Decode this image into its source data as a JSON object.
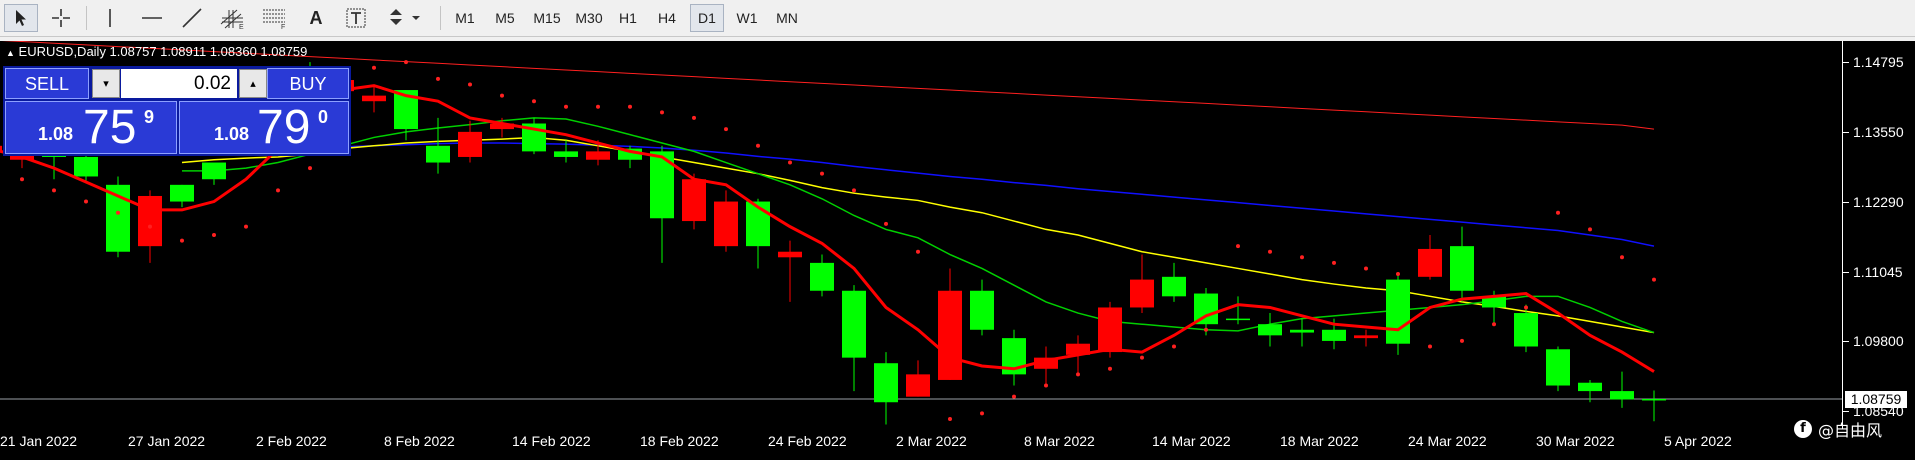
{
  "toolbar": {
    "timeframes": [
      {
        "label": "M1",
        "active": false
      },
      {
        "label": "M5",
        "active": false
      },
      {
        "label": "M15",
        "active": false
      },
      {
        "label": "M30",
        "active": false
      },
      {
        "label": "H1",
        "active": false
      },
      {
        "label": "H4",
        "active": false
      },
      {
        "label": "D1",
        "active": true
      },
      {
        "label": "W1",
        "active": false
      },
      {
        "label": "MN",
        "active": false
      }
    ],
    "tools": [
      "cursor-icon",
      "crosshair-icon",
      "vertical-line-icon",
      "horizontal-line-icon",
      "trendline-icon",
      "equidistant-channel-icon",
      "fibonacci-icon",
      "text-icon",
      "text-label-icon",
      "arrows-icon"
    ],
    "text_tool_label": "A"
  },
  "chart": {
    "symbol_line": "EURUSD,Daily  1.08757 1.08911 1.08360 1.08759",
    "current_price": "1.08759",
    "price_ticks": [
      "1.14795",
      "1.13550",
      "1.12290",
      "1.11045",
      "1.09800",
      "1.08540"
    ],
    "date_ticks": [
      "21 Jan 2022",
      "27 Jan 2022",
      "2 Feb 2022",
      "8 Feb 2022",
      "14 Feb 2022",
      "18 Feb 2022",
      "24 Feb 2022",
      "2 Mar 2022",
      "8 Mar 2022",
      "14 Mar 2022",
      "18 Mar 2022",
      "24 Mar 2022",
      "30 Mar 2022",
      "5 Apr 2022"
    ],
    "colors": {
      "bull": "#00ff00",
      "bear": "#ff0000",
      "ma_fast": "#ff0000",
      "ma_green": "#00d000",
      "ma_yellow": "#ffff00",
      "ma_blue": "#1010ff",
      "ma_slow": "#ff2020",
      "background": "#000000"
    }
  },
  "chart_data": {
    "type": "candlestick",
    "ylim": [
      1.0822,
      1.1518
    ],
    "candles": [
      {
        "o": 1.133,
        "h": 1.136,
        "l": 1.13,
        "c": 1.132
      },
      {
        "o": 1.133,
        "h": 1.134,
        "l": 1.129,
        "c": 1.1305
      },
      {
        "o": 1.131,
        "h": 1.1345,
        "l": 1.127,
        "c": 1.133
      },
      {
        "o": 1.1275,
        "h": 1.132,
        "l": 1.1265,
        "c": 1.131
      },
      {
        "o": 1.114,
        "h": 1.1275,
        "l": 1.113,
        "c": 1.126
      },
      {
        "o": 1.124,
        "h": 1.125,
        "l": 1.112,
        "c": 1.115
      },
      {
        "o": 1.123,
        "h": 1.126,
        "l": 1.122,
        "c": 1.126
      },
      {
        "o": 1.127,
        "h": 1.129,
        "l": 1.126,
        "c": 1.13
      },
      {
        "o": 1.1335,
        "h": 1.1355,
        "l": 1.1315,
        "c": 1.135
      },
      {
        "o": 1.1405,
        "h": 1.145,
        "l": 1.1395,
        "c": 1.143
      },
      {
        "o": 1.1445,
        "h": 1.148,
        "l": 1.142,
        "c": 1.1455
      },
      {
        "o": 1.1448,
        "h": 1.147,
        "l": 1.141,
        "c": 1.1428
      },
      {
        "o": 1.142,
        "h": 1.144,
        "l": 1.139,
        "c": 1.141
      },
      {
        "o": 1.136,
        "h": 1.143,
        "l": 1.134,
        "c": 1.143
      },
      {
        "o": 1.13,
        "h": 1.138,
        "l": 1.128,
        "c": 1.133
      },
      {
        "o": 1.1355,
        "h": 1.1375,
        "l": 1.13,
        "c": 1.131
      },
      {
        "o": 1.137,
        "h": 1.138,
        "l": 1.1345,
        "c": 1.136
      },
      {
        "o": 1.132,
        "h": 1.138,
        "l": 1.1315,
        "c": 1.137
      },
      {
        "o": 1.131,
        "h": 1.134,
        "l": 1.13,
        "c": 1.132
      },
      {
        "o": 1.132,
        "h": 1.134,
        "l": 1.1295,
        "c": 1.1305
      },
      {
        "o": 1.1305,
        "h": 1.133,
        "l": 1.129,
        "c": 1.1325
      },
      {
        "o": 1.12,
        "h": 1.133,
        "l": 1.112,
        "c": 1.132
      },
      {
        "o": 1.127,
        "h": 1.128,
        "l": 1.118,
        "c": 1.1195
      },
      {
        "o": 1.123,
        "h": 1.125,
        "l": 1.114,
        "c": 1.115
      },
      {
        "o": 1.115,
        "h": 1.1235,
        "l": 1.111,
        "c": 1.123
      },
      {
        "o": 1.114,
        "h": 1.116,
        "l": 1.105,
        "c": 1.113
      },
      {
        "o": 1.107,
        "h": 1.1135,
        "l": 1.106,
        "c": 1.112
      },
      {
        "o": 1.095,
        "h": 1.108,
        "l": 1.089,
        "c": 1.107
      },
      {
        "o": 1.087,
        "h": 1.096,
        "l": 1.083,
        "c": 1.094
      },
      {
        "o": 1.092,
        "h": 1.0945,
        "l": 1.088,
        "c": 1.088
      },
      {
        "o": 1.107,
        "h": 1.111,
        "l": 1.091,
        "c": 1.091
      },
      {
        "o": 1.1,
        "h": 1.109,
        "l": 1.099,
        "c": 1.107
      },
      {
        "o": 1.092,
        "h": 1.1,
        "l": 1.09,
        "c": 1.0985
      },
      {
        "o": 1.095,
        "h": 1.097,
        "l": 1.09,
        "c": 1.093
      },
      {
        "o": 1.0975,
        "h": 1.099,
        "l": 1.092,
        "c": 1.0955
      },
      {
        "o": 1.104,
        "h": 1.105,
        "l": 1.095,
        "c": 1.096
      },
      {
        "o": 1.109,
        "h": 1.1135,
        "l": 1.103,
        "c": 1.104
      },
      {
        "o": 1.106,
        "h": 1.112,
        "l": 1.105,
        "c": 1.1095
      },
      {
        "o": 1.101,
        "h": 1.1075,
        "l": 1.099,
        "c": 1.1065
      },
      {
        "o": 1.102,
        "h": 1.106,
        "l": 1.101,
        "c": 1.102
      },
      {
        "o": 1.099,
        "h": 1.103,
        "l": 1.097,
        "c": 1.101
      },
      {
        "o": 1.0995,
        "h": 1.102,
        "l": 1.097,
        "c": 1.1
      },
      {
        "o": 1.098,
        "h": 1.102,
        "l": 1.0965,
        "c": 1.1
      },
      {
        "o": 1.099,
        "h": 1.1,
        "l": 1.097,
        "c": 1.0985
      },
      {
        "o": 1.0975,
        "h": 1.11,
        "l": 1.0955,
        "c": 1.109
      },
      {
        "o": 1.1145,
        "h": 1.117,
        "l": 1.109,
        "c": 1.1095
      },
      {
        "o": 1.107,
        "h": 1.1185,
        "l": 1.105,
        "c": 1.115
      },
      {
        "o": 1.104,
        "h": 1.107,
        "l": 1.101,
        "c": 1.106
      },
      {
        "o": 1.097,
        "h": 1.1045,
        "l": 1.096,
        "c": 1.103
      },
      {
        "o": 1.09,
        "h": 1.097,
        "l": 1.089,
        "c": 1.0965
      },
      {
        "o": 1.089,
        "h": 1.091,
        "l": 1.087,
        "c": 1.0905
      },
      {
        "o": 1.0875,
        "h": 1.0925,
        "l": 1.086,
        "c": 1.089
      },
      {
        "o": 1.08757,
        "h": 1.08911,
        "l": 1.0836,
        "c": 1.08759
      }
    ],
    "ma_fast": [
      1.1325,
      1.131,
      1.129,
      1.1265,
      1.124,
      1.1215,
      1.1215,
      1.123,
      1.127,
      1.1325,
      1.138,
      1.143,
      1.1438,
      1.142,
      1.141,
      1.138,
      1.137,
      1.136,
      1.135,
      1.1335,
      1.132,
      1.131,
      1.127,
      1.126,
      1.122,
      1.1185,
      1.1155,
      1.111,
      1.104,
      1.1,
      1.095,
      1.0935,
      1.093,
      1.0945,
      1.0955,
      1.0965,
      1.096,
      1.099,
      1.1025,
      1.1045,
      1.104,
      1.1025,
      1.101,
      1.1005,
      1.1,
      1.104,
      1.1055,
      1.106,
      1.1065,
      1.103,
      1.099,
      1.096,
      1.0925
    ],
    "ma_green": [
      null,
      null,
      null,
      null,
      null,
      null,
      1.1285,
      1.1285,
      1.129,
      1.13,
      1.1315,
      1.133,
      1.1345,
      1.1355,
      1.1362,
      1.1368,
      1.1375,
      1.138,
      1.1378,
      1.1365,
      1.135,
      1.1335,
      1.132,
      1.13,
      1.128,
      1.126,
      1.1235,
      1.1205,
      1.118,
      1.1165,
      1.1135,
      1.111,
      1.108,
      1.105,
      1.103,
      1.1015,
      1.101,
      1.1005,
      1.1,
      1.0998,
      1.101,
      1.102,
      1.1025,
      1.103,
      1.1035,
      1.104,
      1.1045,
      1.1052,
      1.106,
      1.106,
      1.104,
      1.1015,
      1.0995
    ],
    "ma_yellow": [
      null,
      null,
      null,
      null,
      null,
      null,
      1.13,
      1.1305,
      1.1308,
      1.131,
      1.1315,
      1.1325,
      1.133,
      1.1335,
      1.1338,
      1.134,
      1.1342,
      1.1345,
      1.134,
      1.133,
      1.132,
      1.131,
      1.13,
      1.129,
      1.128,
      1.1268,
      1.1255,
      1.1245,
      1.1238,
      1.1232,
      1.122,
      1.121,
      1.1195,
      1.118,
      1.117,
      1.1155,
      1.114,
      1.113,
      1.112,
      1.111,
      1.11,
      1.109,
      1.1082,
      1.1075,
      1.107,
      1.106,
      1.105,
      1.1042,
      1.1033,
      1.1025,
      1.1015,
      1.1005,
      1.0995
    ],
    "ma_blue": [
      null,
      null,
      null,
      null,
      null,
      null,
      1.132,
      1.132,
      1.1322,
      1.1325,
      1.1327,
      1.1328,
      1.133,
      1.1332,
      1.1334,
      1.1335,
      1.1335,
      1.1334,
      1.1333,
      1.1331,
      1.1329,
      1.1326,
      1.1322,
      1.1317,
      1.1311,
      1.1306,
      1.13,
      1.1293,
      1.1287,
      1.1281,
      1.1275,
      1.127,
      1.1264,
      1.1259,
      1.1253,
      1.1248,
      1.1243,
      1.1238,
      1.1233,
      1.1228,
      1.1223,
      1.1218,
      1.1213,
      1.1208,
      1.1203,
      1.1198,
      1.1193,
      1.1188,
      1.1183,
      1.1178,
      1.117,
      1.1162,
      1.115
    ],
    "ma_slow": [
      1.152,
      1.1517,
      1.1514,
      1.1511,
      1.1508,
      1.1505,
      1.1502,
      1.1499,
      1.1496,
      1.1493,
      1.149,
      1.1487,
      1.1484,
      1.1481,
      1.1478,
      1.1475,
      1.1472,
      1.1469,
      1.1466,
      1.1463,
      1.146,
      1.1457,
      1.1454,
      1.1451,
      1.1448,
      1.1445,
      1.1442,
      1.1439,
      1.1436,
      1.1433,
      1.143,
      1.1427,
      1.1424,
      1.1421,
      1.1418,
      1.1415,
      1.1412,
      1.1409,
      1.1406,
      1.1403,
      1.14,
      1.1397,
      1.1394,
      1.1391,
      1.1388,
      1.1385,
      1.1382,
      1.1379,
      1.1376,
      1.1373,
      1.137,
      1.1367,
      1.136
    ],
    "sar": [
      1.129,
      1.127,
      1.125,
      1.123,
      1.121,
      1.1185,
      1.116,
      1.117,
      1.1185,
      1.125,
      1.129,
      1.141,
      1.147,
      1.148,
      1.145,
      1.144,
      1.142,
      1.141,
      1.14,
      1.14,
      1.14,
      1.139,
      1.138,
      1.136,
      1.133,
      1.13,
      1.128,
      1.125,
      1.119,
      1.114,
      1.084,
      1.085,
      1.088,
      1.09,
      1.092,
      1.093,
      1.095,
      1.097,
      1.1,
      1.115,
      1.114,
      1.113,
      1.112,
      1.111,
      1.11,
      1.097,
      1.098,
      1.101,
      1.104,
      1.121,
      1.118,
      1.113,
      1.109
    ]
  },
  "trade_panel": {
    "sell_label": "SELL",
    "buy_label": "BUY",
    "lot": "0.02",
    "down_arrow": "▾",
    "up_arrow": "▴",
    "bid_big_small": "1.08",
    "bid_main": "75",
    "bid_frac": "9",
    "ask_big_small": "1.08",
    "ask_main": "79",
    "ask_frac": "0"
  },
  "watermark": {
    "logo_letter": "f",
    "text": "@自由风"
  }
}
